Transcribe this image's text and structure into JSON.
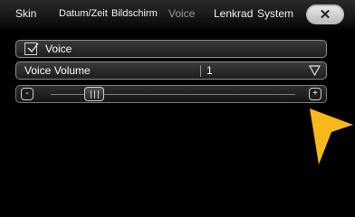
{
  "tabs": [
    "Skin",
    "Datum/Zeit",
    "Bildschirm",
    "Voice",
    "Lenkrad",
    "System"
  ],
  "active_tab": "Voice",
  "close_icon": "close-icon",
  "voice": {
    "checked": true,
    "label": "Voice"
  },
  "volume": {
    "label": "Voice Volume",
    "value": "1",
    "icon": "dropdown-triangle-icon"
  },
  "slider": {
    "minus_label": "-",
    "plus_label": "+",
    "level": 0.15
  },
  "colors": {
    "accent_arrow": "#f6b81b",
    "background": "#000000",
    "border": "#8c8c8c"
  }
}
